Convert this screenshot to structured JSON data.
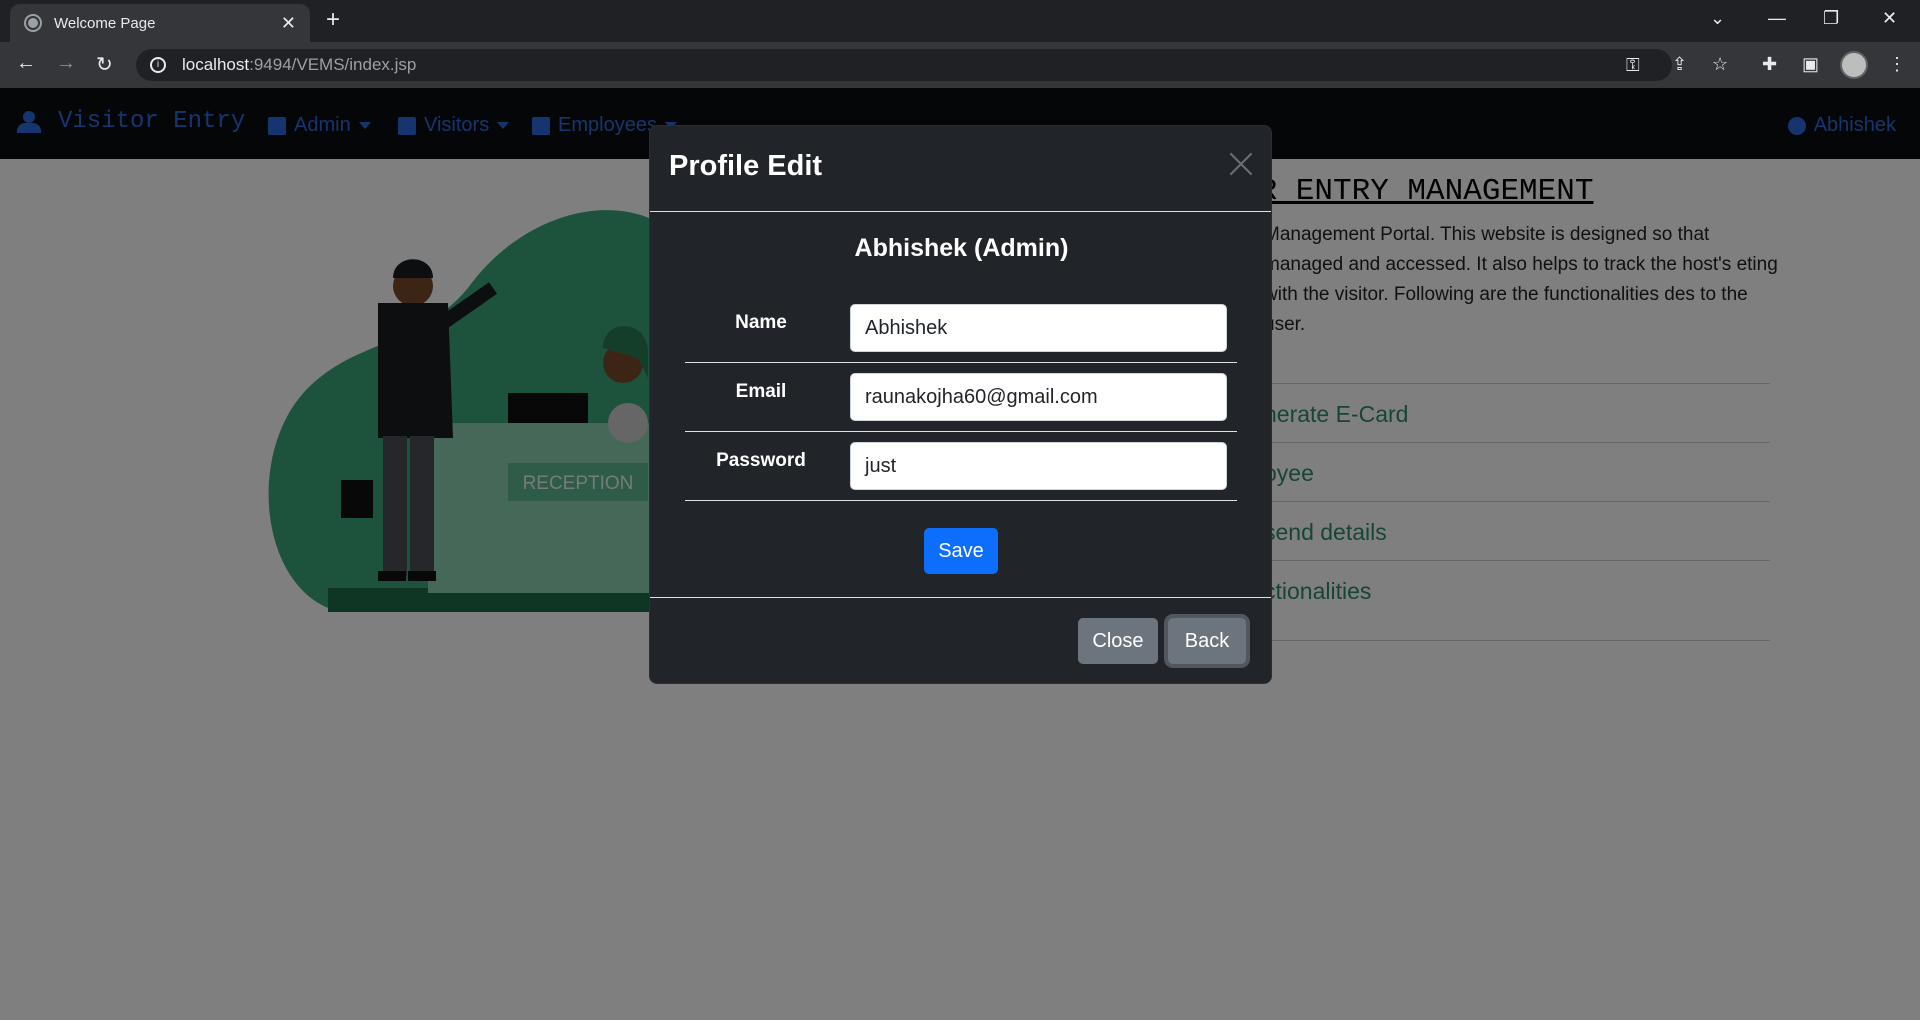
{
  "browser": {
    "tab_title": "Welcome Page",
    "url_host": "localhost",
    "url_path": ":9494/VEMS/index.jsp"
  },
  "navbar": {
    "brand": "Visitor Entry",
    "items": [
      {
        "label": "Admin"
      },
      {
        "label": "Visitors"
      },
      {
        "label": "Employees"
      }
    ],
    "user": "Abhishek"
  },
  "content": {
    "heading": "OR ENTRY MANAGEMENT",
    "paragraph": "Management Portal. This website is designed so that managed and accessed. It also helps to track the host's eting with the visitor. Following are the functionalities des to the user.",
    "list_partial_top": "r",
    "features": [
      "nerate E-Card",
      "oyee",
      "send details",
      "ctionalities"
    ],
    "reception_sign": "RECEPTION"
  },
  "modal": {
    "title": "Profile Edit",
    "profile_name": "Abhishek (Admin)",
    "fields": [
      {
        "label": "Name",
        "value": "Abhishek"
      },
      {
        "label": "Email",
        "value": "raunakojha60@gmail.com"
      },
      {
        "label": "Password",
        "value": "just"
      }
    ],
    "save_label": "Save",
    "close_label": "Close",
    "back_label": "Back"
  },
  "colors": {
    "accent": "#0d6efd",
    "navbar_text": "#2d6bdd",
    "modal_bg": "#212529",
    "secondary": "#6c757d",
    "illustration_green": "#3aa57a"
  }
}
